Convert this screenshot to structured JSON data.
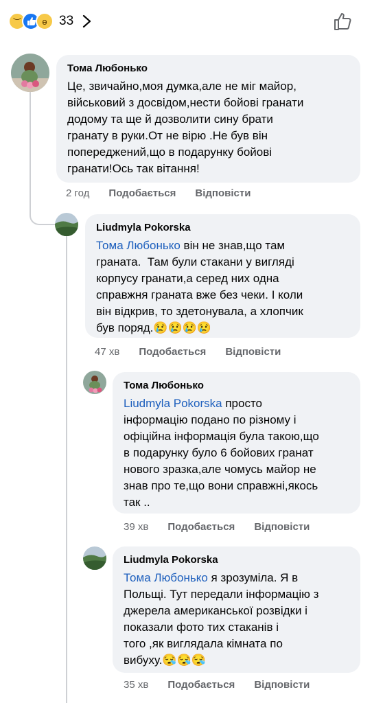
{
  "reactions": {
    "count": "33",
    "types": [
      "sad",
      "like",
      "wow"
    ]
  },
  "comments": [
    {
      "author": "Тома Любонько",
      "mention": "",
      "text": "Це, звичайно,моя думка,але не міг майор,\nвійськовий з досвідом,нести бойові гранати\nдодому та ще й дозволити сину брати\nгранату в руки.От не вірю .Не був він\nпопереджений,що в подарунку бойові\nгранати!Ось так вітання!",
      "emoji": "",
      "time": "2 год",
      "like_label": "Подобається",
      "reply_label": "Відповісти"
    },
    {
      "author": "Liudmyla Pokorska",
      "mention": "Тома Любонько",
      "text": " він не знав,що там\nграната.  Там були стакани у вигляді\nкорпусу гранати,а серед них одна\nсправжня граната вже без чеки. І коли\nвін відкрив, то здетонувала, а хлопчик\nбув поряд.",
      "emoji": "😢😢😢😢",
      "time": "47 хв",
      "like_label": "Подобається",
      "reply_label": "Відповісти"
    },
    {
      "author": "Тома Любонько",
      "mention": "Liudmyla Pokorska",
      "text": " просто\nінформацію подано по різному і\nофіційна інформація була такою,що\nв подарунку було 6 бойових гранат\nнового зразка,але чомусь майор не\nзнав про те,що вони справжні,якось\nтак ..",
      "emoji": "",
      "time": "39 хв",
      "like_label": "Подобається",
      "reply_label": "Відповісти"
    },
    {
      "author": "Liudmyla Pokorska",
      "mention": "Тома Любонько",
      "text": " я зрозуміла. Я в\nПольщі. Тут передали інформацію з\nджерела американської розвідки і\nпоказали фото тих стаканів і\nтого ,як виглядала кімната по\nвибуху.",
      "emoji": "😪😪😪",
      "time": "35 хв",
      "like_label": "Подобається",
      "reply_label": "Відповісти"
    }
  ]
}
